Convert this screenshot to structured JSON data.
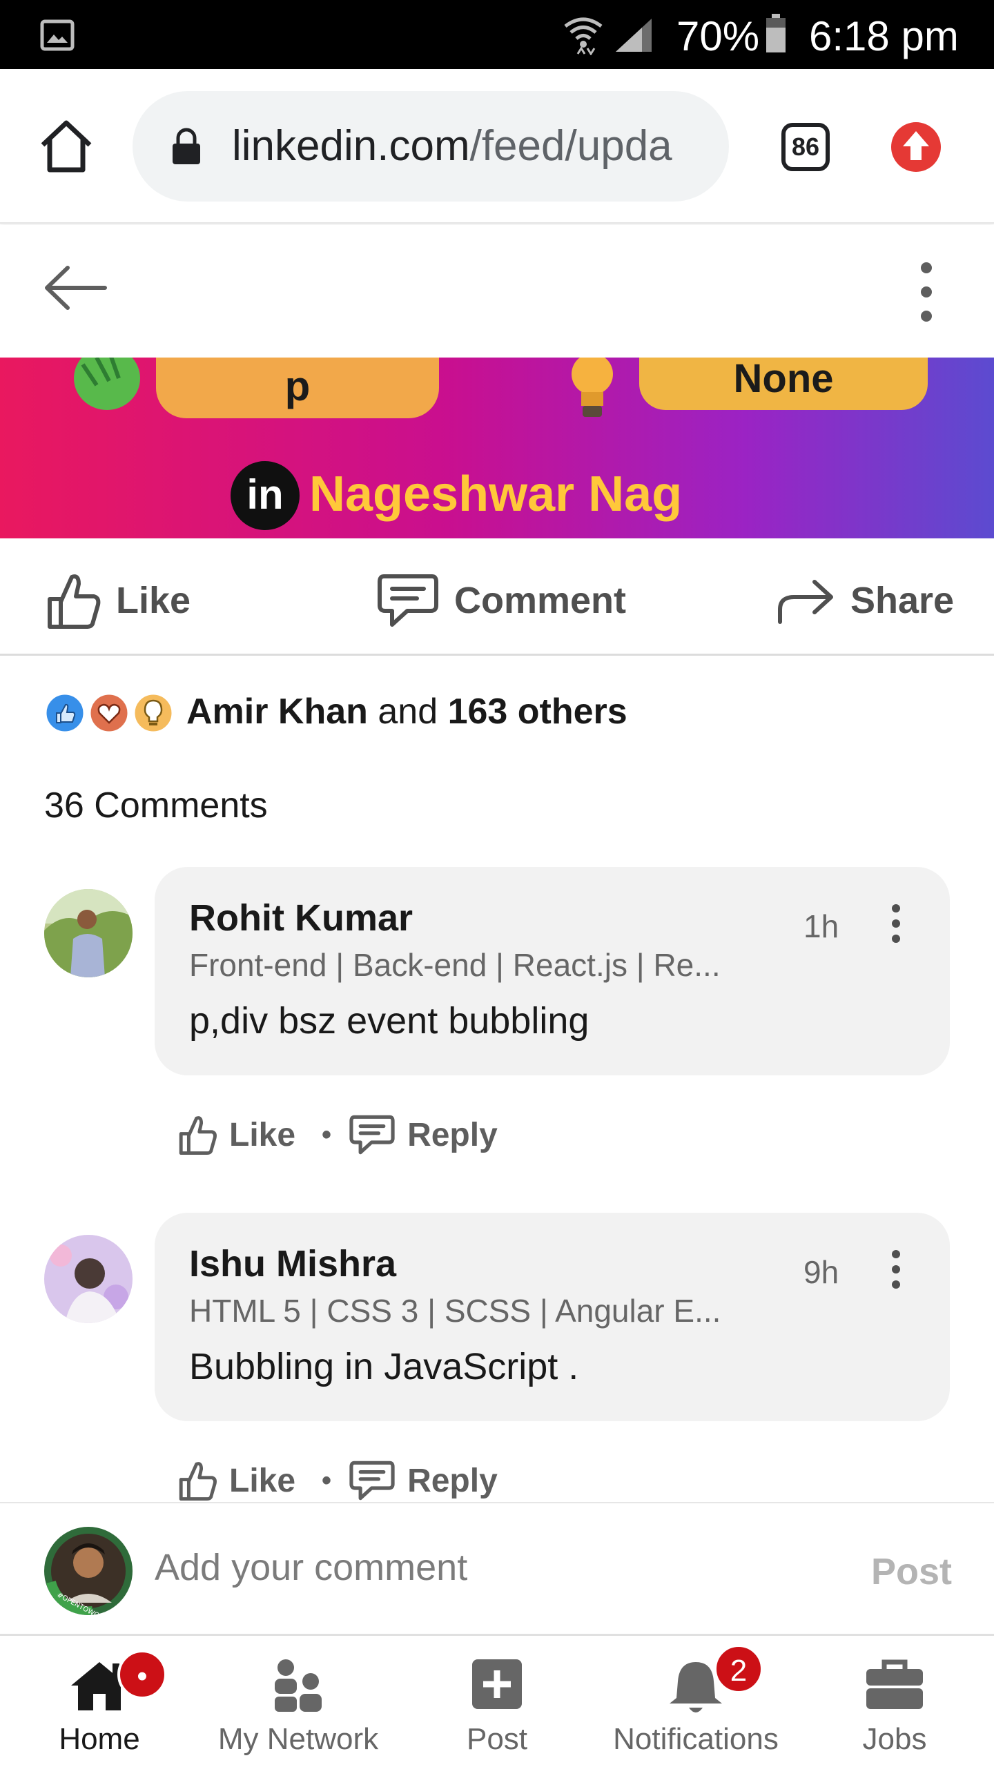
{
  "status_bar": {
    "battery_percent": "70%",
    "time": "6:18 pm"
  },
  "browser": {
    "url_domain": "linkedin.com",
    "url_path": "/feed/upda",
    "tab_count": "86"
  },
  "banner": {
    "pill_left": "p",
    "pill_right": "None",
    "in_badge": "in",
    "author": "Nageshwar Nag"
  },
  "actions": {
    "like": "Like",
    "comment": "Comment",
    "share": "Share"
  },
  "reactions": {
    "first_name": "Amir Khan",
    "connector": " and ",
    "others": "163 others"
  },
  "comments_count": "36 Comments",
  "comments": [
    {
      "name": "Rohit Kumar",
      "headline": "Front-end | Back-end | React.js | Re...",
      "body": "p,div bsz event bubbling",
      "time": "1h",
      "like": "Like",
      "reply": "Reply"
    },
    {
      "name": "Ishu Mishra",
      "headline": "HTML 5 | CSS 3 | SCSS | Angular E...",
      "body": "Bubbling in JavaScript .",
      "time": "9h",
      "like": "Like",
      "reply": "Reply"
    }
  ],
  "add_comment": {
    "placeholder": "Add your comment",
    "post": "Post",
    "avatar_ring_text": "#OPENTOWORK"
  },
  "bottom_nav": {
    "items": [
      {
        "label": "Home",
        "icon": "home-icon",
        "active": true,
        "badge": "•"
      },
      {
        "label": "My Network",
        "icon": "network-icon",
        "active": false
      },
      {
        "label": "Post",
        "icon": "post-plus-icon",
        "active": false
      },
      {
        "label": "Notifications",
        "icon": "bell-icon",
        "active": false,
        "badge": "2"
      },
      {
        "label": "Jobs",
        "icon": "briefcase-icon",
        "active": false
      }
    ]
  },
  "colors": {
    "linkedin_blue": "#0a66c2",
    "badge_red": "#cc1016",
    "banner_gold": "#ffc83a",
    "update_red": "#e53935"
  }
}
